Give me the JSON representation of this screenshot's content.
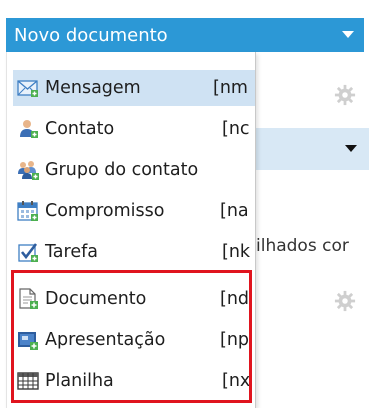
{
  "header": {
    "new_document_label": "Novo documento"
  },
  "background": {
    "partial_text": "ilhados cor"
  },
  "menu": {
    "items": [
      {
        "label": "Mensagem",
        "code": "[nm",
        "icon": "envelope-icon",
        "selected": true
      },
      {
        "label": "Contato",
        "code": "[nc",
        "icon": "contact-icon"
      },
      {
        "label": "Grupo do contato",
        "code": "",
        "icon": "contact-group-icon"
      },
      {
        "label": "Compromisso",
        "code": "[na",
        "icon": "calendar-icon"
      },
      {
        "label": "Tarefa",
        "code": "[nk",
        "icon": "task-check-icon"
      },
      {
        "label": "Documento",
        "code": "[nd",
        "icon": "document-icon"
      },
      {
        "label": "Apresentação",
        "code": "[np",
        "icon": "presentation-icon"
      },
      {
        "label": "Planilha",
        "code": "[nx",
        "icon": "spreadsheet-icon"
      }
    ]
  },
  "colors": {
    "accent": "#2c98d6",
    "highlight": "#e0141e",
    "selected_bg": "#cfe2f3"
  }
}
